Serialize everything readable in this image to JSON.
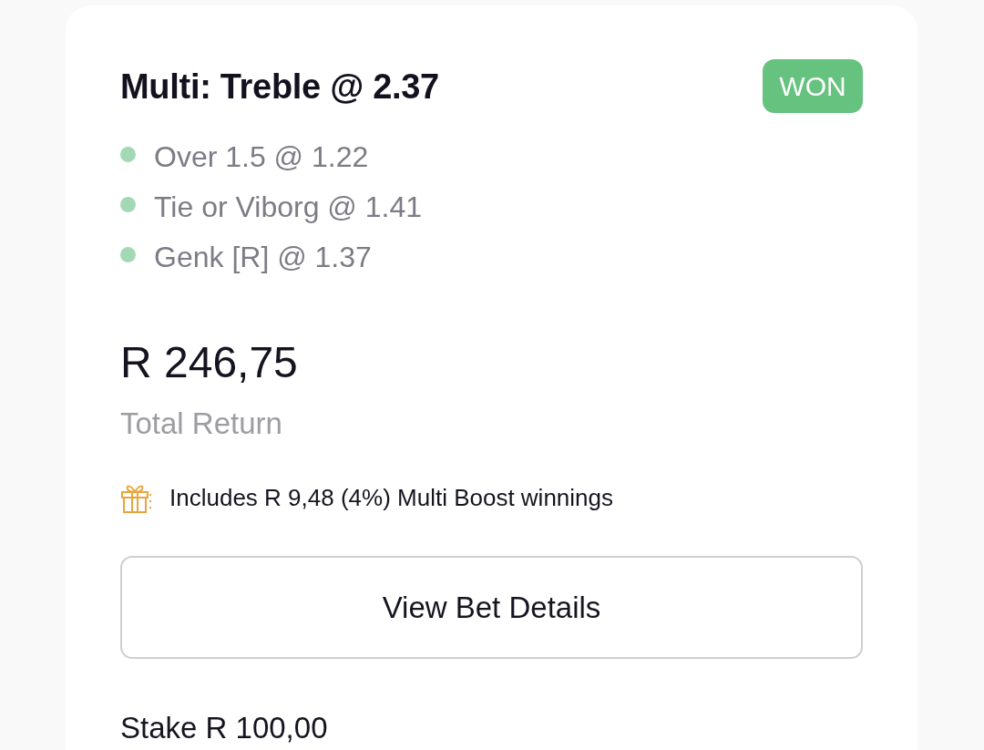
{
  "bet": {
    "title": "Multi: Treble @ 2.37",
    "status": {
      "label": "WON",
      "kind": "won"
    },
    "legs": [
      {
        "label": "Over 1.5 @ 1.22",
        "won": true
      },
      {
        "label": "Tie or Viborg @ 1.41",
        "won": true
      },
      {
        "label": "Genk [R] @ 1.37",
        "won": true
      }
    ],
    "total_return": {
      "amount": "R 246,75",
      "label": "Total Return"
    },
    "boost": {
      "text": "Includes R 9,48 (4%) Multi Boost winnings"
    },
    "details_button": {
      "label": "View Bet Details"
    },
    "stake": "Stake R 100,00"
  }
}
